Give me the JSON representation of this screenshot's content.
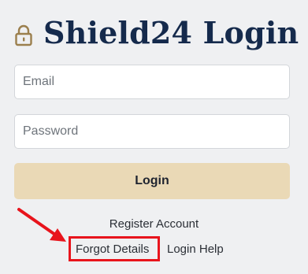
{
  "header": {
    "title": "Shield24 Login",
    "icon": "lock-icon",
    "accent_color": "#9b7f4d",
    "title_color": "#152a4c"
  },
  "form": {
    "email_placeholder": "Email",
    "password_placeholder": "Password",
    "login_label": "Login",
    "login_color": "#ead9b6"
  },
  "links": {
    "register": "Register Account",
    "forgot": "Forgot Details",
    "help": "Login Help"
  },
  "annotation": {
    "highlight_color": "#e8141c",
    "arrow": "arrow-icon"
  }
}
